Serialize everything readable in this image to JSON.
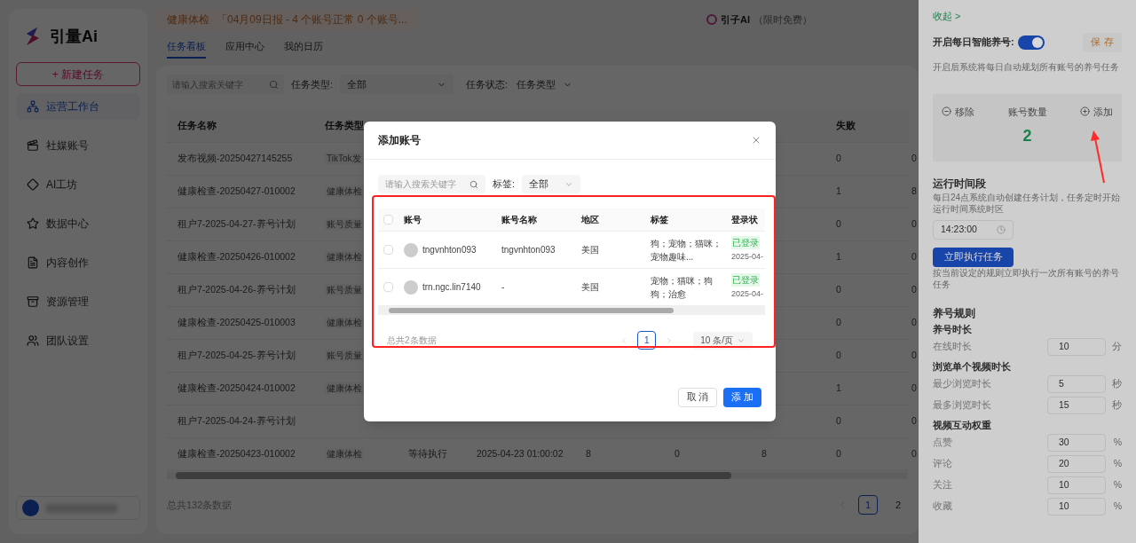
{
  "sidebar": {
    "logo": "引量Ai",
    "new_button": "+ 新建任务",
    "items": [
      {
        "label": "运营工作台",
        "selected": true
      },
      {
        "label": "社媒账号",
        "selected": false
      },
      {
        "label": "AI工坊",
        "selected": false
      },
      {
        "label": "数据中心",
        "selected": false
      },
      {
        "label": "内容创作",
        "selected": false
      },
      {
        "label": "资源管理",
        "selected": false
      },
      {
        "label": "团队设置",
        "selected": false
      }
    ]
  },
  "notice": {
    "tag": "健康体检",
    "text": "「04月09日报 - 4 个账号正常 0 个账号..."
  },
  "promo": {
    "name": "引子AI",
    "note": "（限时免费）"
  },
  "tabs": [
    {
      "label": "任务看板",
      "selected": true
    },
    {
      "label": "应用中心",
      "selected": false
    },
    {
      "label": "我的日历",
      "selected": false
    }
  ],
  "filters": {
    "search_placeholder": "请输入搜索关键字",
    "type_label": "任务类型:",
    "type_value": "全部",
    "status_label": "任务状态:",
    "status_value": "任务类型"
  },
  "table": {
    "columns": {
      "name": "任务名称",
      "type": "任务类型",
      "fail": "失败"
    },
    "rows": [
      {
        "name": "发布视频-20250427145255",
        "type": "TikTok发",
        "fail": "0",
        "last": "0"
      },
      {
        "name": "健康检查-20250427-010002",
        "type": "健康体检",
        "fail": "1",
        "last": "8"
      },
      {
        "name": "租户7-2025-04-27-养号计划",
        "type": "账号质量",
        "fail": "0",
        "last": "0"
      },
      {
        "name": "健康检查-20250426-010002",
        "type": "健康体检",
        "fail": "1",
        "last": "0"
      },
      {
        "name": "租户7-2025-04-26-养号计划",
        "type": "账号质量",
        "fail": "0",
        "last": "0"
      },
      {
        "name": "健康检查-20250425-010003",
        "type": "健康体检",
        "fail": "0",
        "last": "0"
      },
      {
        "name": "租户7-2025-04-25-养号计划",
        "type": "账号质量",
        "fail": "0",
        "last": "0"
      },
      {
        "name": "健康检查-20250424-010002",
        "type": "健康体检",
        "fail": "1",
        "last": "0"
      },
      {
        "name": "租户7-2025-04-24-养号计划",
        "fail": "0",
        "last": "0"
      },
      {
        "name": "健康检查-20250423-010002",
        "type": "健康体检",
        "status": "等待执行",
        "time": "2025-04-23 01:00:02",
        "c5": "8",
        "c6": "0",
        "c7": "8",
        "fail": "0",
        "last": "0"
      }
    ],
    "total": "总共132条数据",
    "pages": [
      {
        "label": "1",
        "selected": true
      },
      {
        "label": "2",
        "selected": false
      }
    ]
  },
  "modal": {
    "title": "添加账号",
    "search_placeholder": "请输入搜索关键字",
    "tag_label": "标签:",
    "tag_value": "全部",
    "select_all_checked": false,
    "columns": [
      "账号",
      "账号名称",
      "地区",
      "标签",
      "登录状"
    ],
    "rows": [
      {
        "checked": false,
        "account": "tngvnhton093",
        "name": "tngvnhton093",
        "region": "美国",
        "tags": "狗；宠物；猫咪；宠物趣味...",
        "status": "已登录",
        "date": "2025-04-"
      },
      {
        "checked": false,
        "account": "trn.ngc.lin7140",
        "name": "-",
        "region": "美国",
        "tags": "宠物；猫咪；狗狗；治愈",
        "status": "已登录",
        "date": "2025-04-"
      }
    ],
    "total": "总共2条数据",
    "pages": [
      {
        "label": "1",
        "selected": true
      }
    ],
    "page_size": "10 条/页",
    "cancel": "取 消",
    "confirm": "添 加"
  },
  "panel": {
    "collapse": "收起 >",
    "toggle_label": "开启每日智能养号:",
    "toggle_on": true,
    "save": "保 存",
    "toggle_hint": "开启后系统将每日自动规划所有账号的养号任务",
    "remove": "移除",
    "count_label": "账号数量",
    "add": "添加",
    "count": "2",
    "schedule_title": "运行时间段",
    "schedule_hint": "每日24点系统自动创建任务计划，任务定时开始运行时间系统时区",
    "time": "14:23:00",
    "run_button": "立即执行任务",
    "run_hint": "按当前设定的规则立即执行一次所有账号的养号任务",
    "rules_title": "养号规则",
    "groups": [
      {
        "title": "养号时长",
        "fields": [
          {
            "label": "在线时长",
            "value": "10",
            "unit": "分"
          }
        ]
      },
      {
        "title": "浏览单个视频时长",
        "fields": [
          {
            "label": "最少浏览时长",
            "value": "5",
            "unit": "秒"
          },
          {
            "label": "最多浏览时长",
            "value": "15",
            "unit": "秒"
          }
        ]
      },
      {
        "title": "视频互动权重",
        "fields": [
          {
            "label": "点赞",
            "value": "30",
            "unit": "%"
          },
          {
            "label": "评论",
            "value": "20",
            "unit": "%"
          },
          {
            "label": "关注",
            "value": "10",
            "unit": "%"
          },
          {
            "label": "收藏",
            "value": "10",
            "unit": "%"
          }
        ]
      }
    ]
  }
}
